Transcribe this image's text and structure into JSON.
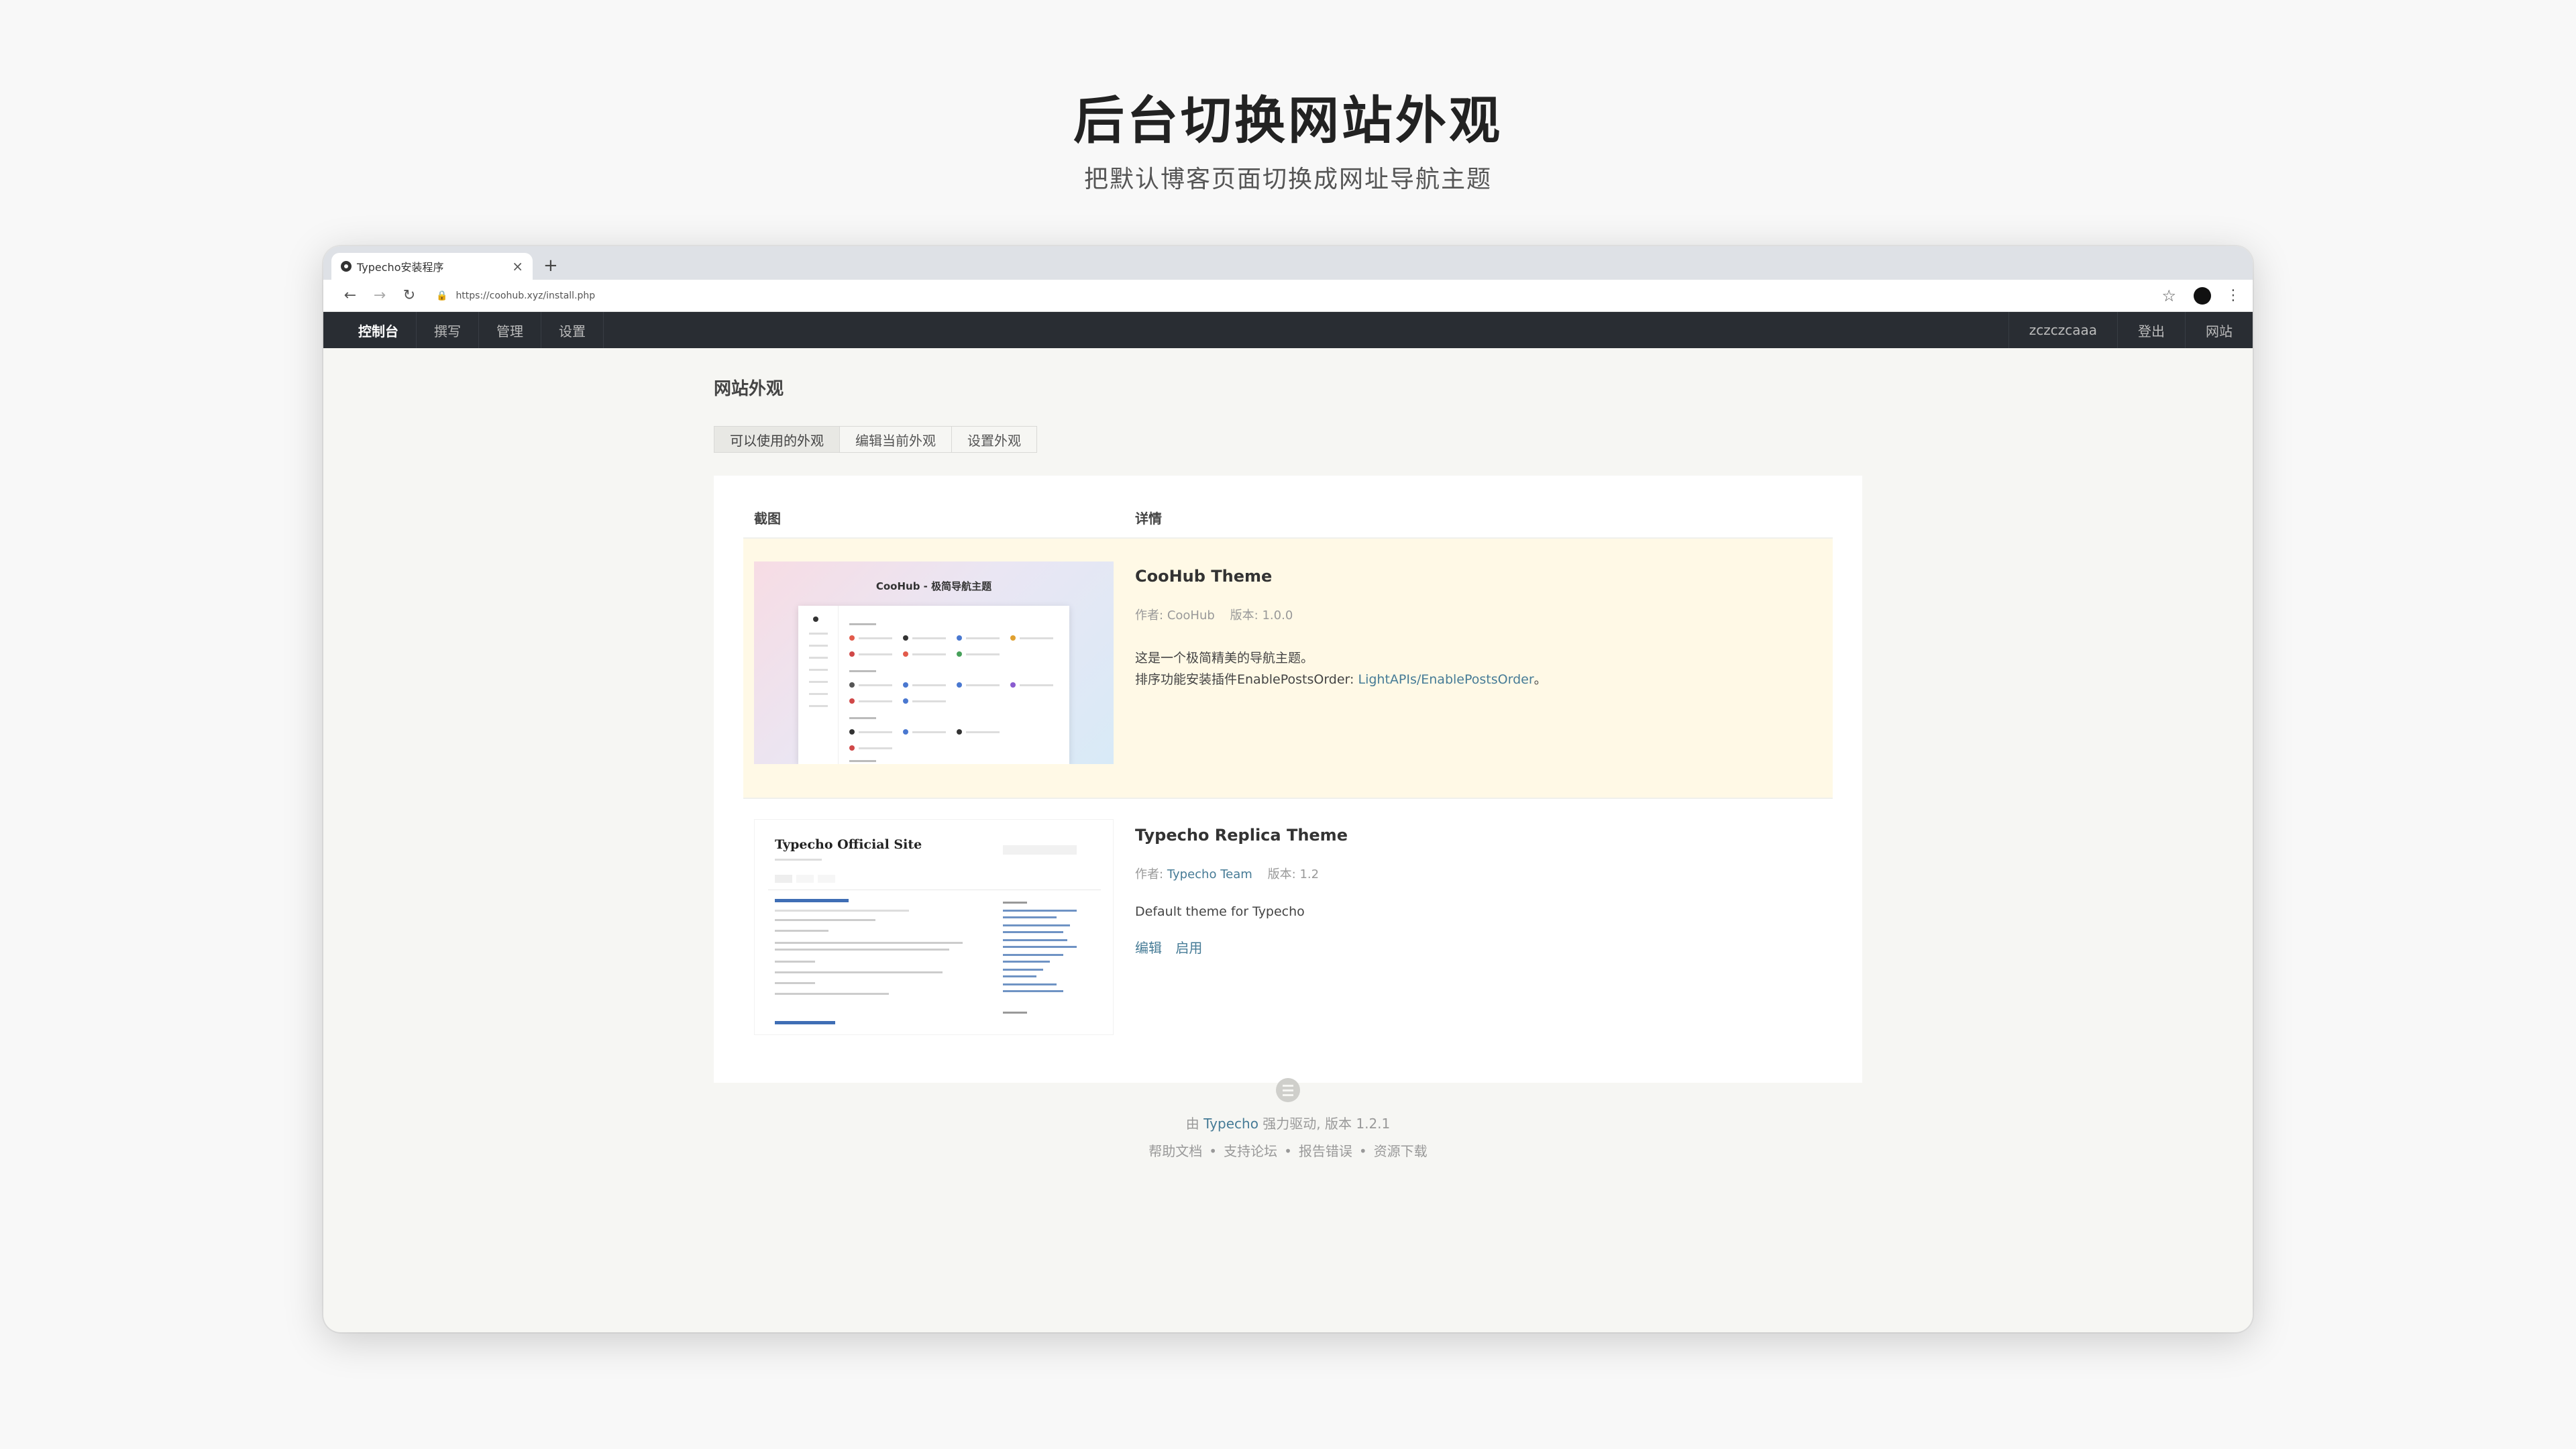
{
  "hero": {
    "title": "后台切换网站外观",
    "subtitle": "把默认博客页面切换成网址导航主题"
  },
  "browser": {
    "tab_title": "Typecho安装程序",
    "tab_close": "×",
    "new_tab": "+",
    "url": "https://coohub.xyz/install.php"
  },
  "adminbar": {
    "menu": [
      "控制台",
      "撰写",
      "管理",
      "设置"
    ],
    "user": "zczczcaaa",
    "logout": "登出",
    "site": "网站"
  },
  "page": {
    "title": "网站外观",
    "tabs": [
      "可以使用的外观",
      "编辑当前外观",
      "设置外观"
    ],
    "columns": {
      "screenshot": "截图",
      "details": "详情"
    }
  },
  "themes": [
    {
      "screenshot_caption": "CooHub - 极简导航主题",
      "name": "CooHub Theme",
      "author_label": "作者:",
      "author": "CooHub",
      "version_label": "版本:",
      "version": "1.0.0",
      "desc_line1": "这是一个极简精美的导航主题。",
      "desc_line2_prefix": "排序功能安装插件EnablePostsOrder:",
      "desc_link": "LightAPIs/EnablePostsOrder",
      "desc_line2_suffix": "。"
    },
    {
      "screenshot_site_title": "Typecho Official Site",
      "name": "Typecho Replica Theme",
      "author_label": "作者:",
      "author": "Typecho Team",
      "version_label": "版本:",
      "version": "1.2",
      "desc": "Default theme for Typecho",
      "action_edit": "编辑",
      "action_enable": "启用"
    }
  ],
  "footer": {
    "powered_prefix": "由",
    "powered_link": "Typecho",
    "powered_suffix": "强力驱动, 版本 1.2.1",
    "links": [
      "帮助文档",
      "支持论坛",
      "报告错误",
      "资源下载"
    ],
    "separator": "•"
  }
}
